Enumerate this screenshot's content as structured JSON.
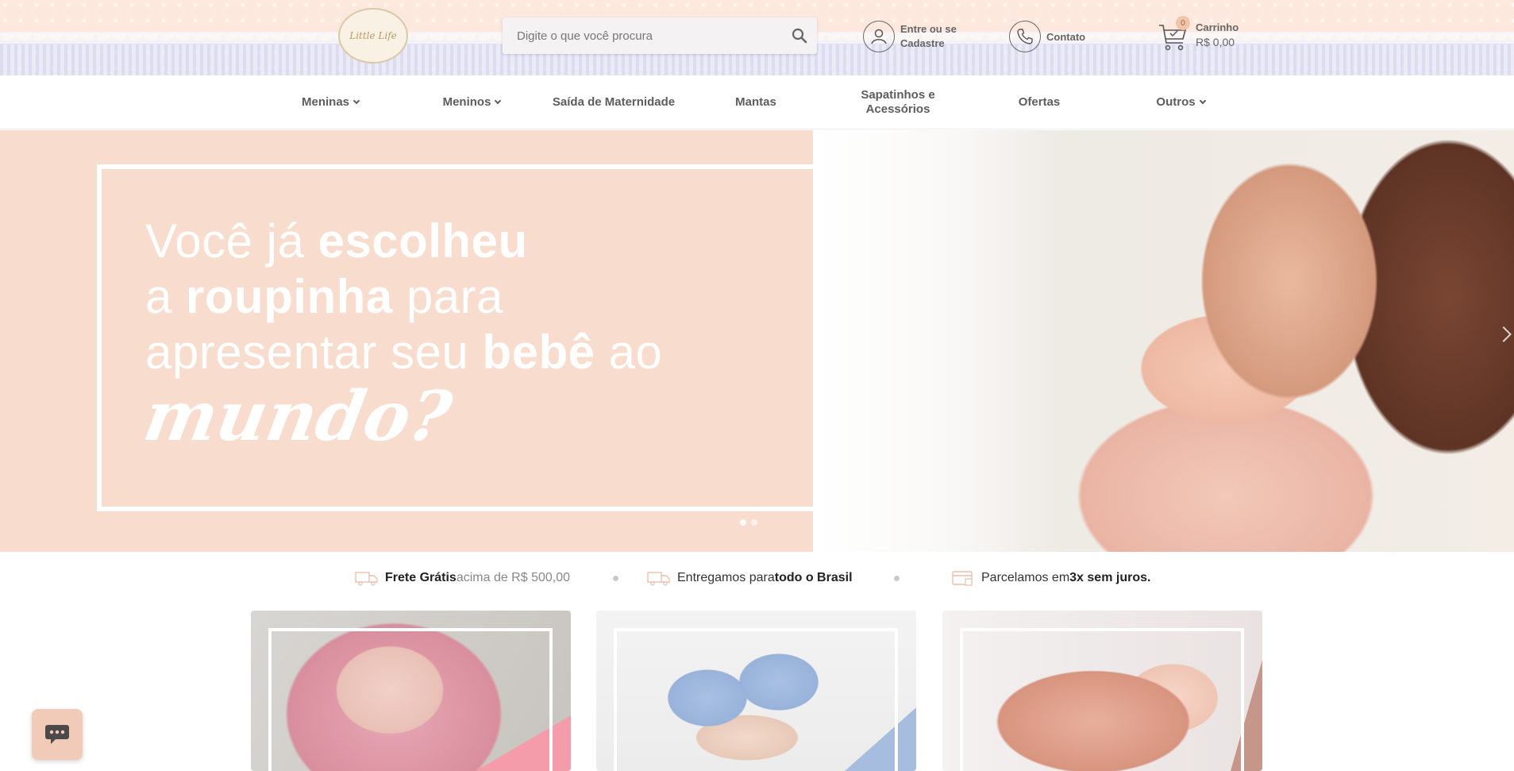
{
  "header": {
    "logo_alt": "Little Life",
    "search": {
      "placeholder": "Digite o que você procura",
      "value": ""
    },
    "account_label_1": "Entre ou se",
    "account_label_2": "Cadastre",
    "contact_label": "Contato",
    "cart": {
      "label": "Carrinho",
      "total": "R$ 0,00",
      "count": "0"
    }
  },
  "nav": {
    "items": [
      {
        "label": "Meninas",
        "has_dropdown": true
      },
      {
        "label": "Meninos",
        "has_dropdown": true
      },
      {
        "label": "Saída de Maternidade",
        "has_dropdown": false
      },
      {
        "label": "Mantas",
        "has_dropdown": false
      },
      {
        "label": "Sapatinhos e",
        "label2": "Acessórios",
        "has_dropdown": false
      },
      {
        "label": "Ofertas",
        "has_dropdown": false
      },
      {
        "label": "Outros",
        "has_dropdown": true
      }
    ]
  },
  "hero": {
    "line1_a": "Você já ",
    "line1_b": "escolheu",
    "line2_a": "a ",
    "line2_b": "roupinha",
    "line2_c": " para",
    "line3_a": "apresentar seu ",
    "line3_b": "bebê",
    "line3_c": " ao",
    "line4": "mundo?",
    "slides": 2,
    "active_slide": 1
  },
  "benefits": [
    {
      "icon": "truck-icon",
      "bold": "Frete Grátis",
      "text": " acima de R$ 500,00"
    },
    {
      "icon": "truck-icon",
      "text": "Entregamos para ",
      "bold": "todo o Brasil"
    },
    {
      "icon": "card-icon",
      "text": "Parcelamos em ",
      "bold": "3x sem juros."
    }
  ],
  "colors": {
    "hero_bg": "#f8dccd",
    "accent_peach": "#f2cbb8",
    "nav_text": "#5d5d5d"
  }
}
